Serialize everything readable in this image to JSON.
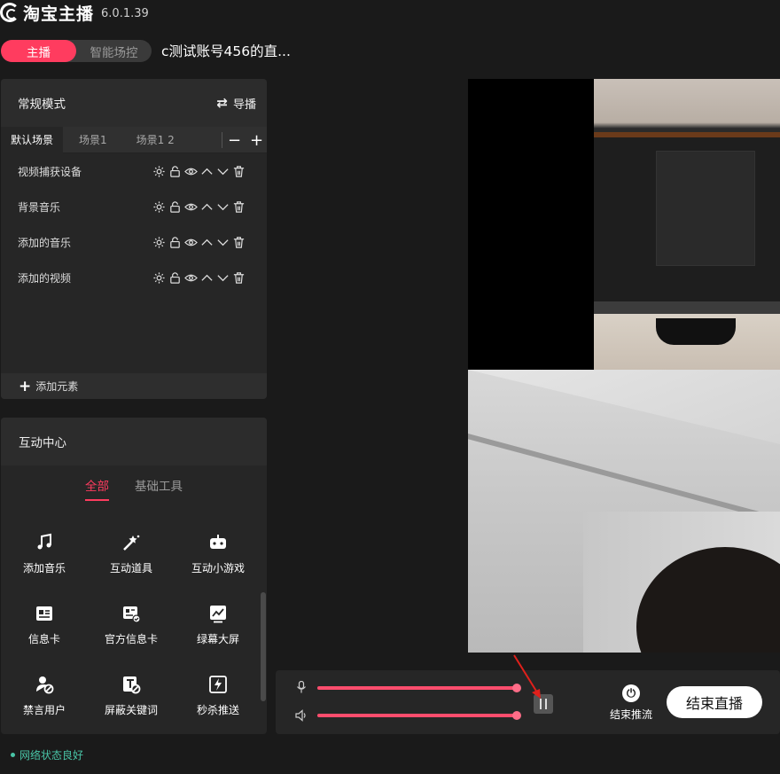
{
  "app": {
    "name": "淘宝主播",
    "version": "6.0.1.39"
  },
  "mode_toggle": {
    "active": "主播",
    "inactive": "智能场控"
  },
  "room_title": "c测试账号456的直...",
  "scene_panel": {
    "title": "常规模式",
    "guide_label": "导播",
    "tabs": [
      "默认场景",
      "场景1",
      "场景1 2"
    ],
    "sources": [
      {
        "name": "视频捕获设备"
      },
      {
        "name": "背景音乐"
      },
      {
        "name": "添加的音乐"
      },
      {
        "name": "添加的视频"
      }
    ],
    "add_element": "添加元素"
  },
  "interaction_panel": {
    "title": "互动中心",
    "tabs": [
      "全部",
      "基础工具"
    ],
    "tools": [
      {
        "label": "添加音乐",
        "icon": "music-note-icon"
      },
      {
        "label": "互动道具",
        "icon": "magic-wand-icon"
      },
      {
        "label": "互动小游戏",
        "icon": "game-controller-icon"
      },
      {
        "label": "信息卡",
        "icon": "info-card-icon"
      },
      {
        "label": "官方信息卡",
        "icon": "official-card-icon"
      },
      {
        "label": "绿幕大屏",
        "icon": "chart-screen-icon"
      },
      {
        "label": "禁言用户",
        "icon": "mute-user-icon"
      },
      {
        "label": "屏蔽关键词",
        "icon": "block-keyword-icon"
      },
      {
        "label": "秒杀推送",
        "icon": "flash-push-icon"
      }
    ]
  },
  "control_bar": {
    "mic_volume": 1.0,
    "speaker_volume": 1.0,
    "stop_push_label": "结束推流",
    "end_live_label": "结束直播"
  },
  "status": {
    "network": "网络状态良好"
  },
  "colors": {
    "accent": "#ff3c5f",
    "status_green": "#49c4a6"
  }
}
